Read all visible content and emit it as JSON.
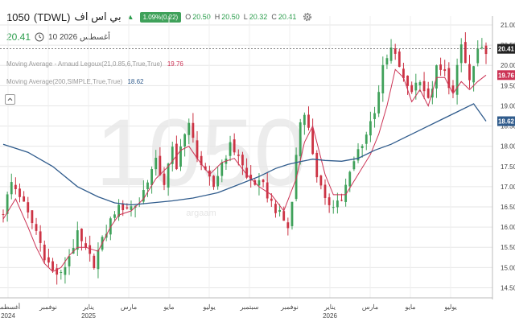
{
  "header": {
    "ticker": "1050",
    "symbol": "(TDWL)",
    "name": "بي اس اف",
    "change_badge": "1.09%(0.22)",
    "open_label": "O",
    "open": "20.50",
    "high_label": "H",
    "high": "20.50",
    "low_label": "L",
    "low": "20.32",
    "close_label": "C",
    "close": "20.41",
    "last_price": "20.41",
    "date": "10 أغسطس 2026"
  },
  "indicators": [
    {
      "name": "Moving Average - Arnaud Legoux(21,0.85,6,True,True)",
      "value": "19.76",
      "color": "#cc3355"
    },
    {
      "name": "Moving Average(200,SIMPLE,True,True)",
      "value": "18.62",
      "color": "#2f5b8c"
    }
  ],
  "watermark": "1050",
  "watermark_sub": "argaam",
  "colors": {
    "up": "#3fa15a",
    "down": "#cc3344",
    "alma": "#cc3355",
    "sma": "#2f5b8c",
    "grid": "#e6e6e6"
  },
  "chart_data": {
    "type": "line",
    "title": "",
    "ylim": [
      14.25,
      21.1
    ],
    "y_ticks": [
      "14.50",
      "15.00",
      "15.50",
      "16.00",
      "16.50",
      "17.00",
      "17.50",
      "18.00",
      "18.50",
      "19.00",
      "19.50",
      "20.00",
      "20.50",
      "21.00"
    ],
    "x_ticks": [
      {
        "label": "أغسطس",
        "year": "2024"
      },
      {
        "label": "نوفمبر",
        "year": ""
      },
      {
        "label": "يناير",
        "year": "2025"
      },
      {
        "label": "مارس",
        "year": ""
      },
      {
        "label": "مايو",
        "year": ""
      },
      {
        "label": "يوليو",
        "year": ""
      },
      {
        "label": "سبتمبر",
        "year": ""
      },
      {
        "label": "نوفمبر",
        "year": ""
      },
      {
        "label": "يناير",
        "year": "2026"
      },
      {
        "label": "مارس",
        "year": ""
      },
      {
        "label": "مايو",
        "year": ""
      },
      {
        "label": "يوليو",
        "year": ""
      }
    ],
    "price_labels": [
      {
        "value": 20.41,
        "text": "20.41",
        "color": "#222222"
      },
      {
        "value": 19.76,
        "text": "19.76",
        "color": "#cc3355"
      },
      {
        "value": 18.62,
        "text": "18.62",
        "color": "#2f5b8c"
      }
    ],
    "current_price": 20.41,
    "close_path": [
      [
        0,
        16.4
      ],
      [
        2,
        17.1
      ],
      [
        4,
        16.8
      ],
      [
        6,
        16.3
      ],
      [
        8,
        15.9
      ],
      [
        10,
        15.3
      ],
      [
        12,
        14.9
      ],
      [
        14,
        14.8
      ],
      [
        16,
        15.3
      ],
      [
        18,
        15.8
      ],
      [
        20,
        15.4
      ],
      [
        22,
        15.1
      ],
      [
        23,
        15.4
      ],
      [
        25,
        15.9
      ],
      [
        27,
        16.4
      ],
      [
        29,
        16.5
      ],
      [
        31,
        16.5
      ],
      [
        33,
        16.6
      ],
      [
        35,
        17.2
      ],
      [
        37,
        17.6
      ],
      [
        39,
        17.1
      ],
      [
        41,
        17.9
      ],
      [
        42,
        17.4
      ],
      [
        43,
        18.1
      ],
      [
        45,
        18.5
      ],
      [
        47,
        17.8
      ],
      [
        49,
        17.3
      ],
      [
        51,
        17.0
      ],
      [
        53,
        17.6
      ],
      [
        55,
        18.0
      ],
      [
        57,
        17.8
      ],
      [
        59,
        17.2
      ],
      [
        61,
        17.1
      ],
      [
        63,
        17.0
      ],
      [
        65,
        16.6
      ],
      [
        67,
        16.3
      ],
      [
        69,
        16.0
      ],
      [
        70,
        16.6
      ],
      [
        71,
        17.8
      ],
      [
        72,
        18.6
      ],
      [
        73,
        18.9
      ],
      [
        74,
        18.4
      ],
      [
        76,
        17.3
      ],
      [
        78,
        16.6
      ],
      [
        80,
        16.6
      ],
      [
        82,
        16.7
      ],
      [
        84,
        17.3
      ],
      [
        86,
        17.9
      ],
      [
        88,
        18.3
      ],
      [
        90,
        18.9
      ],
      [
        92,
        19.9
      ],
      [
        94,
        20.4
      ],
      [
        96,
        20.0
      ],
      [
        97,
        19.6
      ],
      [
        99,
        19.4
      ],
      [
        101,
        19.7
      ],
      [
        103,
        19.1
      ],
      [
        105,
        19.9
      ],
      [
        107,
        19.8
      ],
      [
        109,
        19.3
      ],
      [
        111,
        20.5
      ],
      [
        113,
        19.6
      ],
      [
        115,
        20.3
      ],
      [
        117,
        20.4
      ]
    ],
    "series": [
      {
        "name": "Moving Average - Arnaud Legoux(21,0.85,6,True,True)",
        "x": [
          0,
          3,
          6,
          8,
          10,
          12,
          14,
          16,
          18,
          20,
          23,
          26,
          28,
          31,
          34,
          37,
          40,
          43,
          45,
          47,
          50,
          53,
          56,
          59,
          62,
          65,
          68,
          71,
          73,
          75,
          78,
          80,
          83,
          86,
          89,
          91,
          93,
          95,
          97,
          99,
          101,
          103,
          105,
          107,
          109,
          111,
          113,
          115,
          117
        ],
        "values": [
          16.2,
          16.7,
          16.0,
          15.5,
          15.1,
          14.9,
          15.0,
          15.3,
          15.5,
          15.5,
          15.4,
          16.0,
          16.3,
          16.4,
          16.7,
          17.2,
          17.5,
          17.9,
          18.0,
          17.7,
          17.3,
          17.6,
          17.7,
          17.3,
          17.0,
          16.8,
          16.4,
          17.2,
          18.1,
          18.5,
          17.3,
          16.8,
          16.8,
          17.3,
          17.8,
          18.3,
          19.0,
          19.9,
          19.7,
          19.1,
          19.4,
          19.0,
          19.7,
          19.7,
          19.3,
          19.6,
          19.4,
          19.6,
          19.76
        ]
      },
      {
        "name": "Moving Average(200,SIMPLE,True,True)",
        "x": [
          0,
          6,
          12,
          18,
          23,
          27,
          31,
          36,
          41,
          46,
          52,
          57,
          62,
          66,
          69,
          72,
          75,
          78,
          82,
          86,
          90,
          94,
          98,
          102,
          106,
          110,
          114,
          117
        ],
        "values": [
          18.05,
          17.85,
          17.5,
          17.0,
          16.75,
          16.6,
          16.55,
          16.6,
          16.65,
          16.72,
          16.85,
          17.05,
          17.25,
          17.45,
          17.55,
          17.62,
          17.68,
          17.65,
          17.63,
          17.7,
          17.9,
          18.05,
          18.25,
          18.45,
          18.65,
          18.85,
          19.05,
          18.62
        ]
      }
    ],
    "x_index_count": 118,
    "candle_wick_spread": 0.25,
    "annotations": []
  }
}
